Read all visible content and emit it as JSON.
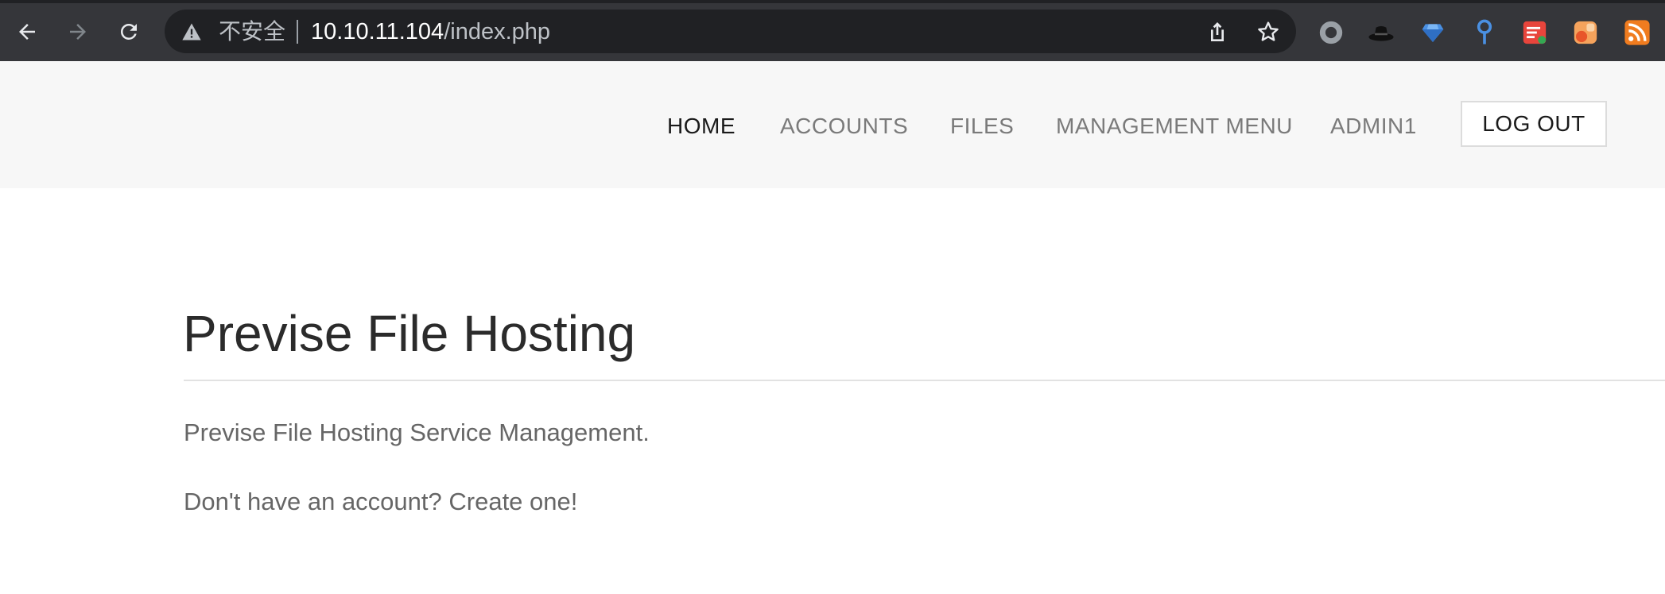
{
  "browser": {
    "security_label": "不安全",
    "url_host": "10.10.11.104",
    "url_path": "/index.php",
    "extensions": [
      "circle-extension-icon",
      "hat-extension-icon",
      "gem-extension-icon",
      "pin-extension-icon",
      "notes-extension-icon",
      "orange-app-extension-icon",
      "rss-extension-icon"
    ]
  },
  "navbar": {
    "items": [
      {
        "label": "HOME",
        "active": true
      },
      {
        "label": "ACCOUNTS",
        "active": false
      },
      {
        "label": "FILES",
        "active": false
      },
      {
        "label": "MANAGEMENT MENU",
        "active": false
      },
      {
        "label": "ADMIN1",
        "active": false
      }
    ],
    "logout_label": "LOG OUT"
  },
  "main": {
    "title": "Previse File Hosting",
    "description": "Previse File Hosting Service Management.",
    "signup_prompt": "Don't have an account? Create one!"
  },
  "colors": {
    "chrome_bg": "#35363a",
    "omnibox_bg": "#202124",
    "navbar_bg": "#f7f7f7",
    "active_nav": "#1a1a1a",
    "inactive_nav": "#7a7a7a",
    "body_text": "#666666"
  }
}
